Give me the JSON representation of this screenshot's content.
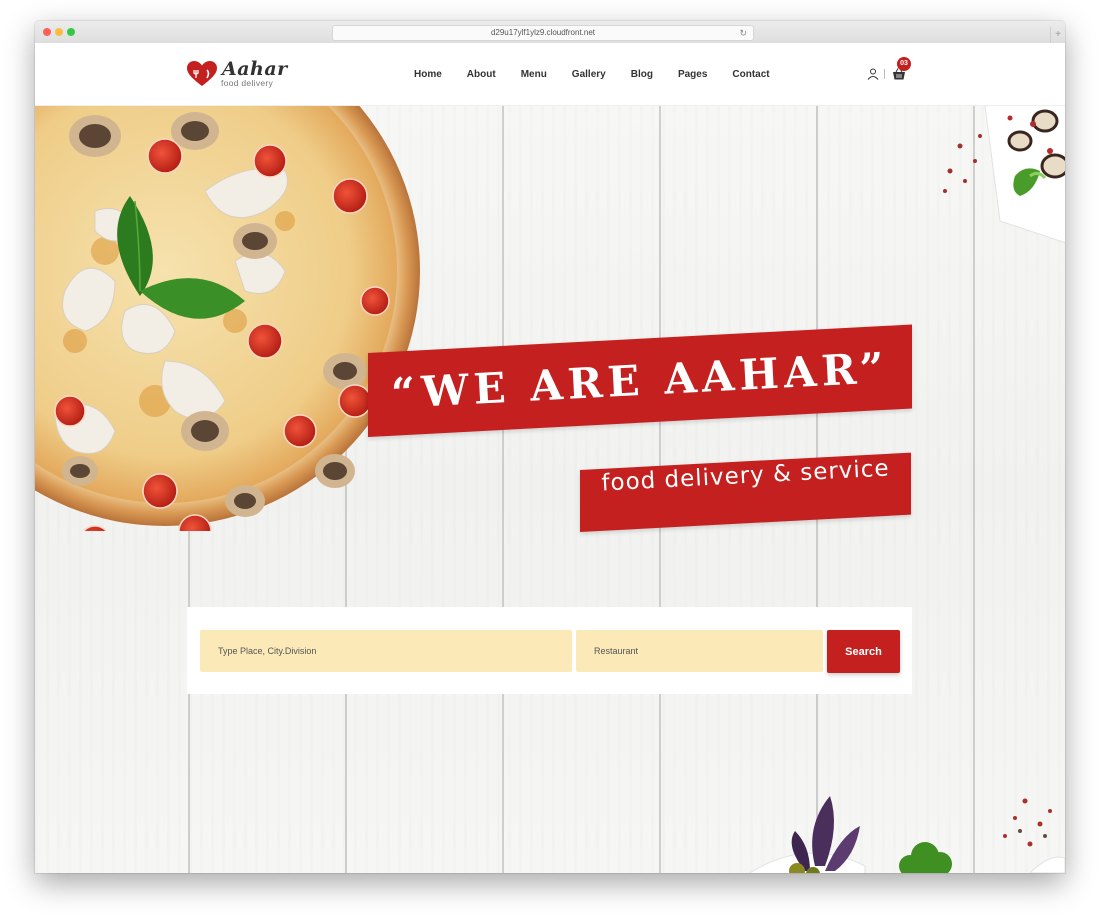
{
  "browser": {
    "url": "d29u17ylf1ylz9.cloudfront.net"
  },
  "brand": {
    "name": "Aahar",
    "tagline": "food delivery",
    "accent_color": "#c4201f"
  },
  "nav": {
    "items": [
      "Home",
      "About",
      "Menu",
      "Gallery",
      "Blog",
      "Pages",
      "Contact"
    ]
  },
  "header_icons": {
    "user_icon": "user-icon",
    "cart_icon": "shopping-basket-icon",
    "cart_count": "03"
  },
  "hero": {
    "title": "“WE ARE AAHAR”",
    "subtitle": "food delivery & service"
  },
  "search": {
    "place_placeholder": "Type Place, City.Division",
    "restaurant_placeholder": "Restaurant",
    "button_label": "Search",
    "input_bg_color": "#fbe9b7"
  }
}
